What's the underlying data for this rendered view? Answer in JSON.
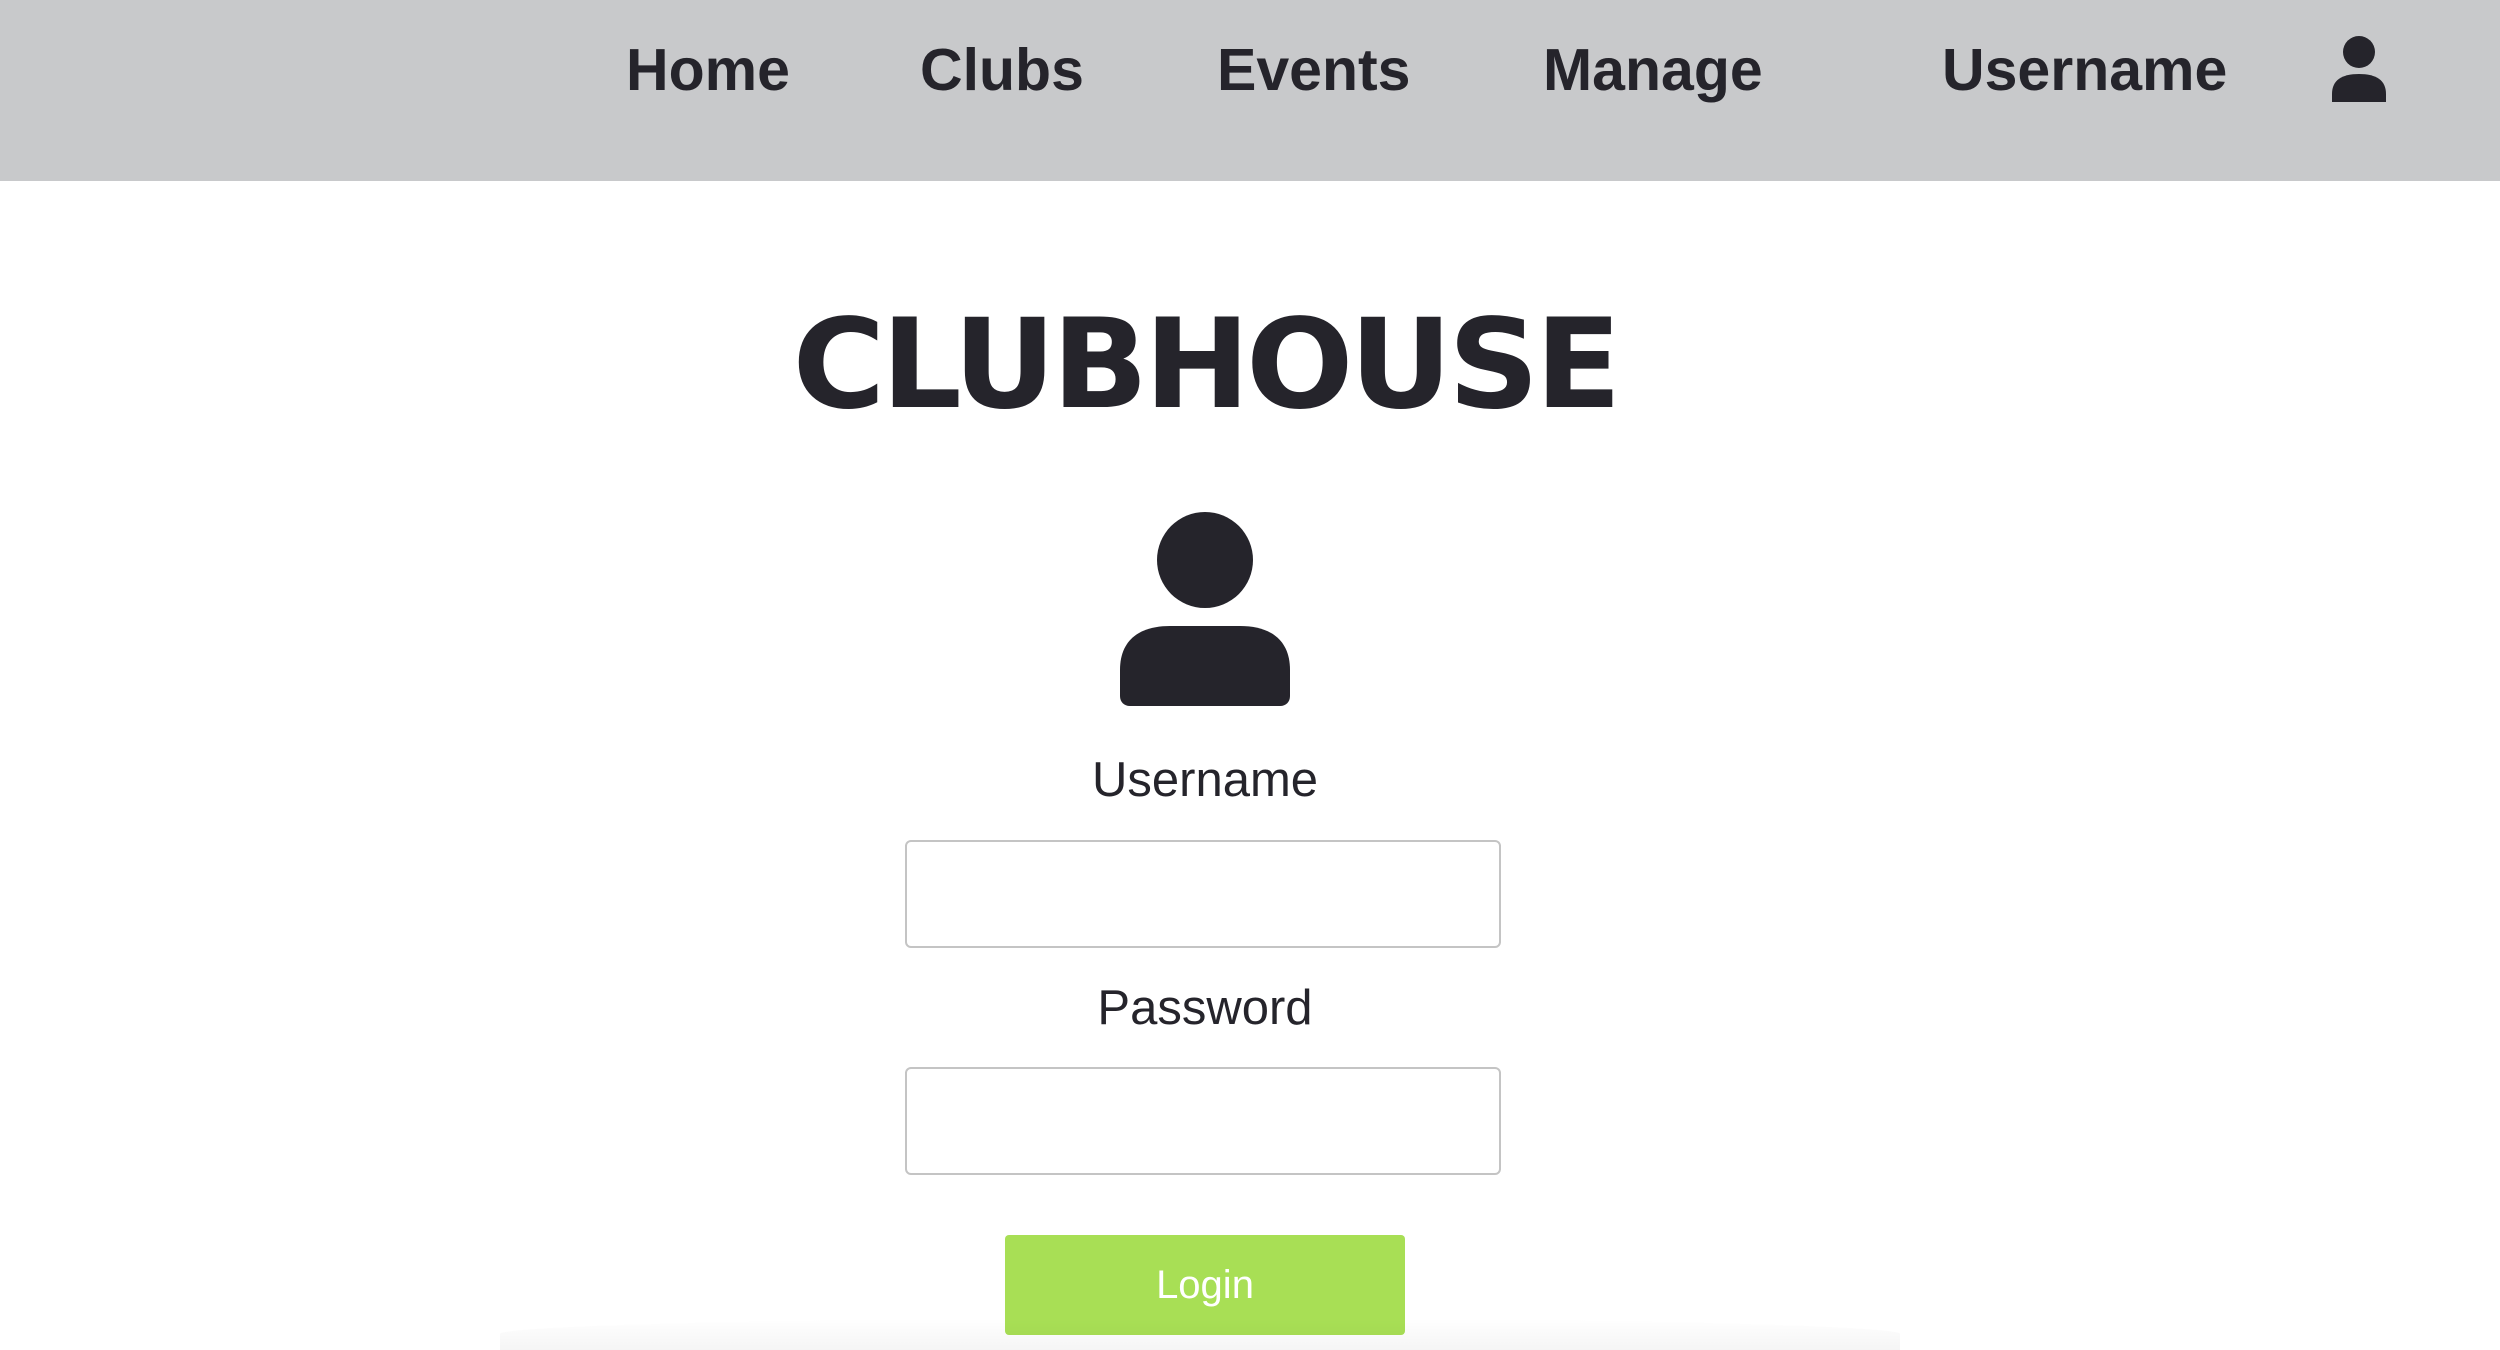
{
  "nav": {
    "items": [
      {
        "label": "Home"
      },
      {
        "label": "Clubs"
      },
      {
        "label": "Events"
      },
      {
        "label": "Manage"
      }
    ],
    "username_label": "Username",
    "profile_icon": "user-icon",
    "background": "#c8c9cb"
  },
  "brand": {
    "title": "CLUBHOUSE"
  },
  "login_form": {
    "avatar_icon": "user-icon",
    "username_label": "Username",
    "username_value": "",
    "password_label": "Password",
    "password_value": "",
    "submit_label": "Login",
    "submit_color": "#a8df55"
  },
  "colors": {
    "text": "#25242b",
    "page_background": "#ffffff"
  }
}
